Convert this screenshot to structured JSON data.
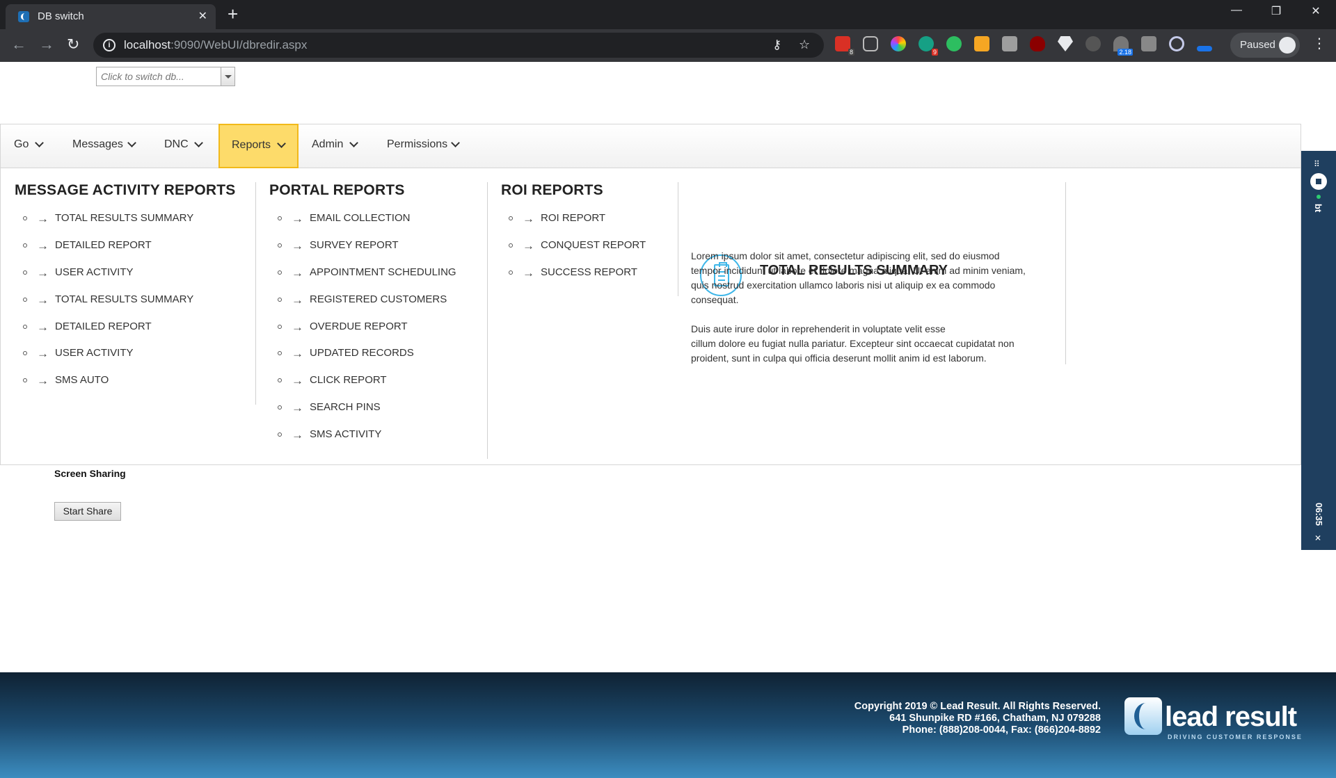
{
  "browser": {
    "tab_title": "DB switch",
    "tab_close": "✕",
    "new_tab": "+",
    "url_host": "localhost",
    "url_rest": ":9090/WebUI/dbredir.aspx",
    "paused_label": "Paused",
    "extension_badges": [
      "8",
      "9",
      "2.18"
    ],
    "window_controls": [
      "—",
      "❐",
      "✕"
    ]
  },
  "db_switch": {
    "placeholder": "Click to switch db..."
  },
  "navbar": {
    "items": [
      {
        "label": "Go"
      },
      {
        "label": "Messages"
      },
      {
        "label": "DNC"
      },
      {
        "label": "Reports",
        "active": true
      },
      {
        "label": "Admin"
      },
      {
        "label": "Permissions"
      }
    ]
  },
  "mega_menu": {
    "columns": [
      {
        "title": "MESSAGE ACTIVITY REPORTS",
        "items": [
          "TOTAL RESULTS SUMMARY",
          "DETAILED REPORT",
          "USER ACTIVITY",
          "TOTAL RESULTS SUMMARY",
          "DETAILED REPORT",
          "USER ACTIVITY",
          "SMS AUTO"
        ]
      },
      {
        "title": "PORTAL REPORTS",
        "items": [
          "EMAIL COLLECTION",
          "SURVEY REPORT",
          "APPOINTMENT SCHEDULING",
          "REGISTERED CUSTOMERS",
          "OVERDUE REPORT",
          "UPDATED RECORDS",
          "CLICK REPORT",
          "SEARCH PINS",
          "SMS ACTIVITY"
        ]
      },
      {
        "title": "ROI REPORTS",
        "items": [
          "ROI REPORT",
          "CONQUEST REPORT",
          "SUCCESS REPORT"
        ]
      }
    ],
    "summary": {
      "title": "TOTAL RESULTS SUMMARY",
      "paragraph1_lines": [
        "Lorem ipsum dolor sit amet, consectetur adipiscing elit, sed do eiusmod",
        "tempor incididunt ut labore et dolore magna aliqua. Ut enim ad minim veniam,",
        "quis nostrud exercitation ullamco laboris nisi ut aliquip ex ea commodo",
        "consequat."
      ],
      "paragraph2_lines": [
        "Duis aute irure dolor in reprehenderit in voluptate velit esse",
        "cillum dolore eu fugiat nulla pariatur. Excepteur sint occaecat cupidatat non",
        "proident, sunt in culpa qui officia deserunt mollit anim id est laborum."
      ]
    }
  },
  "screen_sharing": {
    "title": "Screen Sharing",
    "button_label": "Start Share"
  },
  "side_widget": {
    "label": "bt",
    "timer": "06:35",
    "close": "✕"
  },
  "footer": {
    "lines": [
      "Copyright 2019 © Lead Result. All Rights Reserved.",
      "641 Shunpike RD #166, Chatham, NJ 079288",
      "Phone: (888)208-0044, Fax: (866)204-8892"
    ],
    "logo_text": "lead result",
    "logo_tagline": "DRIVING CUSTOMER RESPONSE"
  },
  "colors": {
    "active_nav": "#fddb6a",
    "accent_icon": "#3eb6e8",
    "footer_dark": "#0f2233",
    "footer_light": "#3c8dc0"
  }
}
